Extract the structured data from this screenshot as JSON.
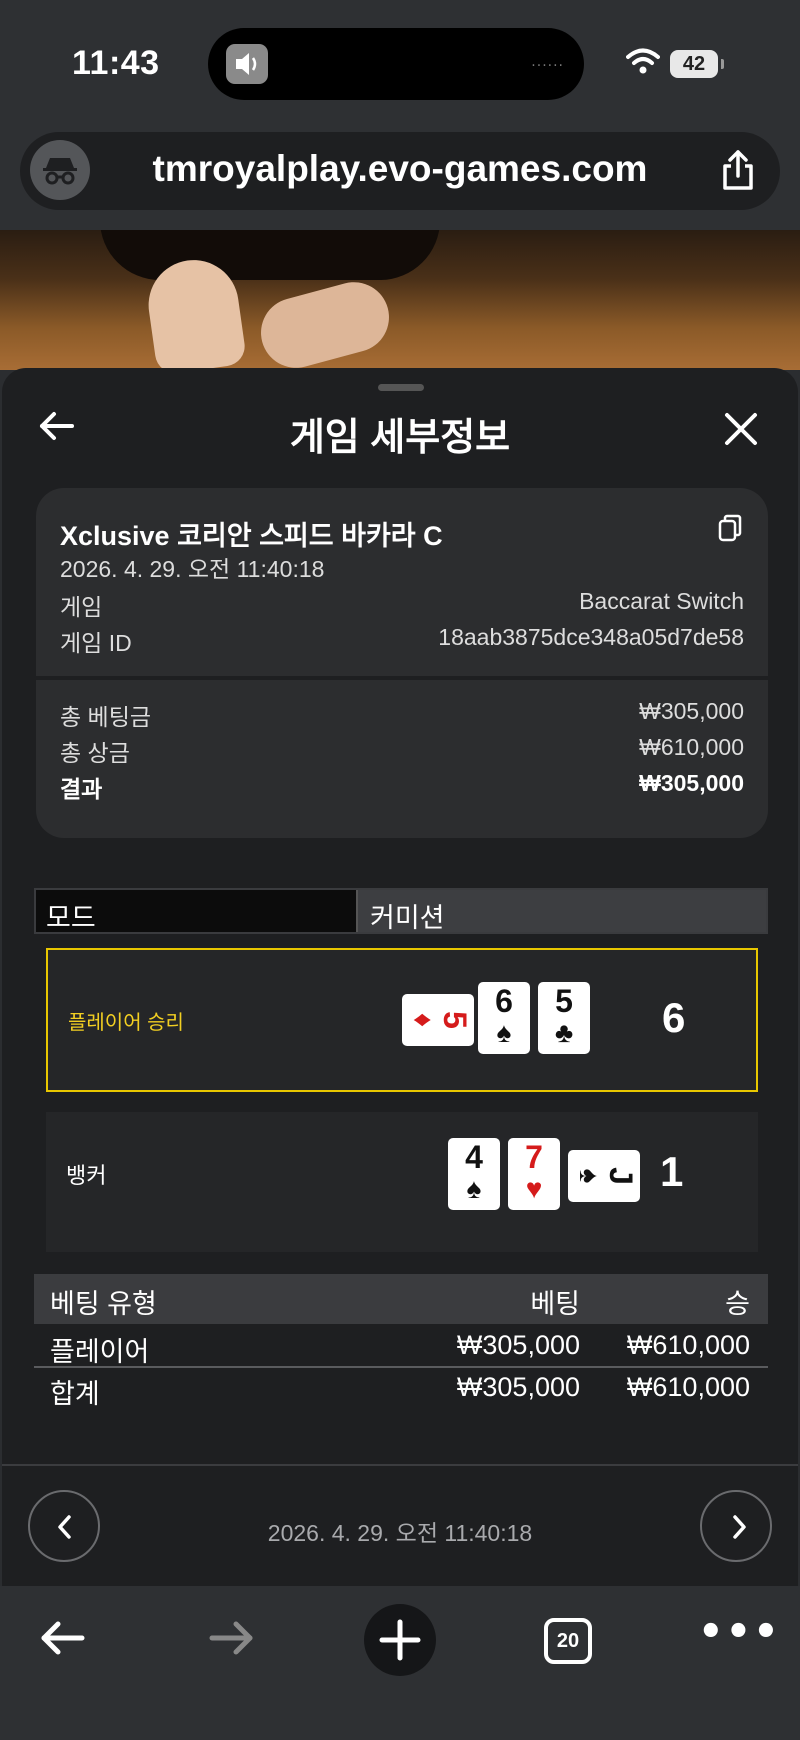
{
  "status": {
    "time": "11:43",
    "battery": "42"
  },
  "browser": {
    "url": "tmroyalplay.evo-games.com",
    "tab_count": "20"
  },
  "header": {
    "title": "게임 세부정보"
  },
  "game": {
    "title": "Xclusive 코리안 스피드 바카라 C",
    "datetime": "2026. 4. 29. 오전 11:40:18",
    "game_label": "게임",
    "game_value": "Baccarat Switch",
    "id_label": "게임 ID",
    "id_value": "18aab3875dce348a05d7de58"
  },
  "summary": {
    "total_bet_label": "총 베팅금",
    "total_bet": "₩305,000",
    "total_win_label": "총 상금",
    "total_win": "₩610,000",
    "result_label": "결과",
    "result": "₩305,000"
  },
  "mode": {
    "label": "모드",
    "value": "커미션"
  },
  "hands": {
    "player": {
      "label": "플레이어 승리",
      "score": "6",
      "cards": [
        {
          "rank": "5",
          "suit": "♦",
          "color": "#d51b1b",
          "orientation": "horizontal"
        },
        {
          "rank": "6",
          "suit": "♠",
          "color": "#111111",
          "orientation": "vertical"
        },
        {
          "rank": "5",
          "suit": "♣",
          "color": "#111111",
          "orientation": "vertical"
        }
      ]
    },
    "banker": {
      "label": "뱅커",
      "score": "1",
      "cards": [
        {
          "rank": "4",
          "suit": "♠",
          "color": "#111111",
          "orientation": "vertical"
        },
        {
          "rank": "7",
          "suit": "♥",
          "color": "#d51b1b",
          "orientation": "vertical"
        },
        {
          "rank": "J",
          "suit": "♠",
          "color": "#111111",
          "orientation": "horizontal"
        }
      ]
    }
  },
  "bets_table": {
    "headers": [
      "베팅 유형",
      "베팅",
      "승"
    ],
    "rows": [
      [
        "플레이어",
        "₩305,000",
        "₩610,000"
      ]
    ],
    "total": [
      "합계",
      "₩305,000",
      "₩610,000"
    ]
  },
  "footer": {
    "datetime": "2026. 4. 29. 오전 11:40:18"
  },
  "colors": {
    "highlight": "#e8c700",
    "panel": "#1e1f21",
    "card_bg": "#2c2d2f"
  }
}
